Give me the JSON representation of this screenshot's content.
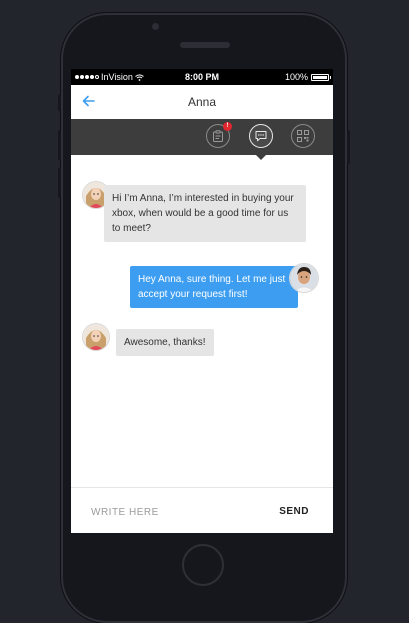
{
  "status_bar": {
    "carrier": "InVision",
    "time": "8:00 PM",
    "battery": "100%"
  },
  "nav": {
    "back_icon": "arrow-left-icon",
    "title": "Anna"
  },
  "toolbar": {
    "tools": [
      {
        "icon": "clipboard-icon",
        "badge": "!"
      },
      {
        "icon": "chat-bubble-icon",
        "active": true
      },
      {
        "icon": "qr-code-icon"
      }
    ]
  },
  "messages": [
    {
      "from": "Anna",
      "direction": "incoming",
      "text": "Hi I’m Anna, I’m interested in buying your xbox, when would be a good time for us to meet?"
    },
    {
      "from": "me",
      "direction": "outgoing",
      "text": "Hey Anna, sure thing. Let me just accept your request first!"
    },
    {
      "from": "Anna",
      "direction": "incoming",
      "text": "Awesome, thanks!"
    }
  ],
  "composer": {
    "placeholder": "WRITE HERE",
    "value": "",
    "send_label": "SEND"
  },
  "colors": {
    "accent": "#3d9ef1",
    "toolbar": "#3d3d3d",
    "badge": "#e0262f",
    "incoming_bubble": "#e5e5e5",
    "background": "#23252d"
  }
}
